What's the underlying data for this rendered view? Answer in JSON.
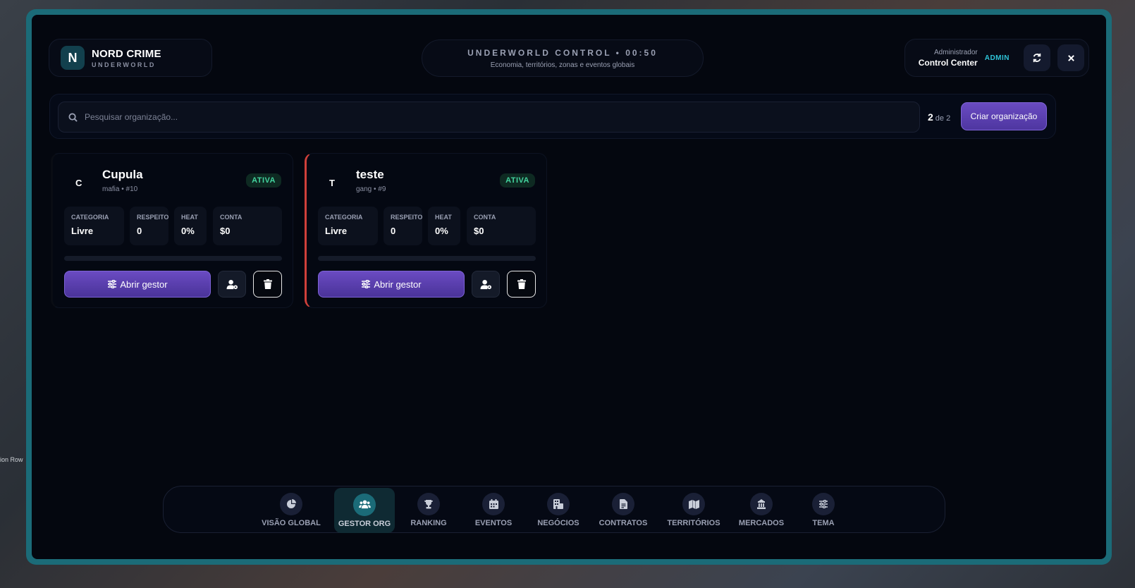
{
  "background": {
    "label": "ion Row"
  },
  "brand": {
    "logo": "N",
    "name": "NORD CRIME",
    "subtitle": "UNDERWORLD"
  },
  "header": {
    "title": "UNDERWORLD CONTROL • 00:50",
    "subtitle": "Economia, territórios, zonas e eventos globais"
  },
  "admin": {
    "role": "Administrador",
    "name": "Control Center",
    "badge": "ADMIN"
  },
  "toolbar": {
    "search_placeholder": "Pesquisar organização...",
    "count_current": "2",
    "count_total": "de 2",
    "create_label": "Criar organização"
  },
  "organizations": [
    {
      "initial": "C",
      "name": "Cupula",
      "meta": "mafia • #10",
      "status": "ATIVA",
      "stats": [
        {
          "label": "CATEGORIA",
          "value": "Livre"
        },
        {
          "label": "RESPEITO",
          "value": "0"
        },
        {
          "label": "HEAT",
          "value": "0%"
        },
        {
          "label": "CONTA",
          "value": "$0"
        }
      ],
      "open_label": "Abrir gestor",
      "progress": 0
    },
    {
      "initial": "T",
      "name": "teste",
      "meta": "gang • #9",
      "status": "ATIVA",
      "stats": [
        {
          "label": "CATEGORIA",
          "value": "Livre"
        },
        {
          "label": "RESPEITO",
          "value": "0"
        },
        {
          "label": "HEAT",
          "value": "0%"
        },
        {
          "label": "CONTA",
          "value": "$0"
        }
      ],
      "open_label": "Abrir gestor",
      "progress": 0
    }
  ],
  "nav": [
    {
      "label": "VISÃO GLOBAL",
      "icon": "pie-chart-icon"
    },
    {
      "label": "GESTOR ORG",
      "icon": "users-icon",
      "active": true
    },
    {
      "label": "RANKING",
      "icon": "trophy-icon"
    },
    {
      "label": "EVENTOS",
      "icon": "calendar-icon"
    },
    {
      "label": "NEGÓCIOS",
      "icon": "building-icon"
    },
    {
      "label": "CONTRATOS",
      "icon": "document-icon"
    },
    {
      "label": "TERRITÓRIOS",
      "icon": "map-icon"
    },
    {
      "label": "MERCADOS",
      "icon": "market-icon"
    },
    {
      "label": "TEMA",
      "icon": "sliders-icon"
    }
  ],
  "colors": {
    "frame": "#1b6b78",
    "accent_purple": "#6a4bc2",
    "status_green": "#43d39e",
    "teal_badge": "#2ec4d8",
    "card2_stripe": "#d0403a"
  }
}
